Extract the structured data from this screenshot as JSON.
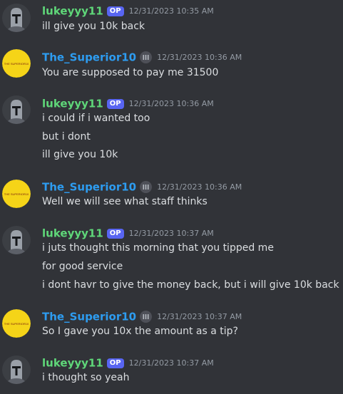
{
  "messages": [
    {
      "author": "lukeyyy11",
      "author_color": "#5fd779",
      "tag": "OP",
      "timestamp": "12/31/2023 10:35 AM",
      "avatar": "mandalorian-helmet-avatar",
      "lines": [
        "ill give you 10k back"
      ]
    },
    {
      "author": "The_Superior10",
      "author_color": "#2d9cf0",
      "badge_icon": "role-icon",
      "timestamp": "12/31/2023 10:36 AM",
      "avatar": "superior-logo-avatar",
      "lines": [
        "You are supposed to pay me 31500"
      ]
    },
    {
      "author": "lukeyyy11",
      "author_color": "#5fd779",
      "tag": "OP",
      "timestamp": "12/31/2023 10:36 AM",
      "avatar": "mandalorian-helmet-avatar",
      "lines": [
        "i could if i wanted too",
        "but i dont",
        "ill give you 10k"
      ]
    },
    {
      "author": "The_Superior10",
      "author_color": "#2d9cf0",
      "badge_icon": "role-icon",
      "timestamp": "12/31/2023 10:36 AM",
      "avatar": "superior-logo-avatar",
      "lines": [
        "Well we will see what staff thinks"
      ]
    },
    {
      "author": "lukeyyy11",
      "author_color": "#5fd779",
      "tag": "OP",
      "timestamp": "12/31/2023 10:37 AM",
      "avatar": "mandalorian-helmet-avatar",
      "lines": [
        "i juts thought this morning that you tipped me",
        "for good service",
        "i dont havr to give the money back, but i will give 10k back"
      ]
    },
    {
      "author": "The_Superior10",
      "author_color": "#2d9cf0",
      "badge_icon": "role-icon",
      "timestamp": "12/31/2023 10:37 AM",
      "avatar": "superior-logo-avatar",
      "lines": [
        "So I gave you 10x the amount as a tip?"
      ]
    },
    {
      "author": "lukeyyy11",
      "author_color": "#5fd779",
      "tag": "OP",
      "timestamp": "12/31/2023 10:37 AM",
      "avatar": "mandalorian-helmet-avatar",
      "lines": [
        "i thought so yeah"
      ]
    }
  ],
  "logo_text": "THE SUPERIOR10"
}
